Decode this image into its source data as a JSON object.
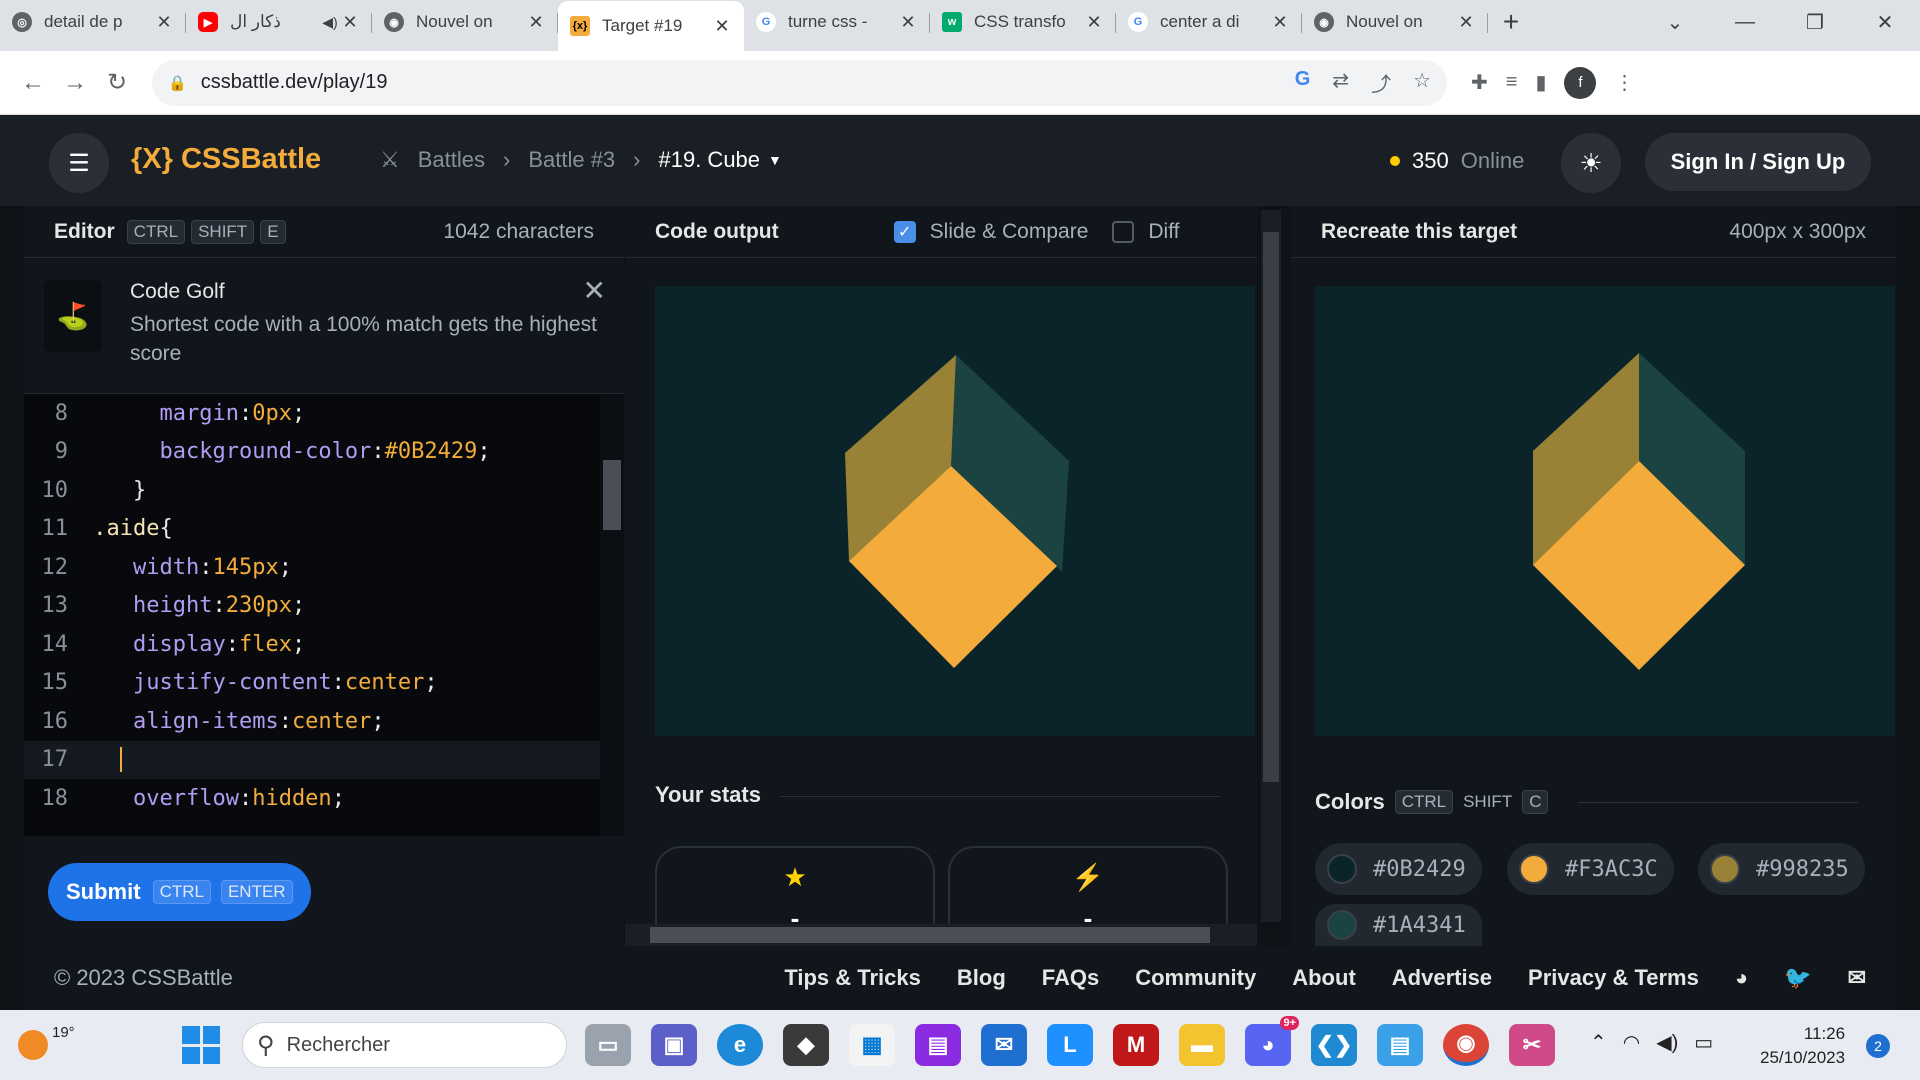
{
  "browser": {
    "tabs": [
      {
        "title": "detail de p",
        "favicon": "globe-icon"
      },
      {
        "title": "ذكار ال",
        "favicon": "youtube-icon"
      },
      {
        "title": "Nouvel on",
        "favicon": "chrome-icon"
      },
      {
        "title": "Target #19",
        "favicon": "cssbattle-icon",
        "active": true
      },
      {
        "title": "turne css -",
        "favicon": "google-icon"
      },
      {
        "title": "CSS transfo",
        "favicon": "w3schools-icon"
      },
      {
        "title": "center a di",
        "favicon": "google-icon"
      },
      {
        "title": "Nouvel on",
        "favicon": "chrome-icon"
      }
    ],
    "url": "cssbattle.dev/play/19",
    "profile_initial": "f"
  },
  "header": {
    "logo": "{X} CSSBattle",
    "crumbs": [
      "Battles",
      "Battle #3",
      "#19. Cube"
    ],
    "online_count": "350",
    "online_label": "Online",
    "signin": "Sign In / Sign Up"
  },
  "editor": {
    "title": "Editor",
    "shortcut": [
      "CTRL",
      "SHIFT",
      "E"
    ],
    "chars": "1042 characters",
    "tip_title": "Code Golf",
    "tip_text": "Shortest code with a 100% match gets the highest score",
    "lines": [
      {
        "n": "8",
        "prop": "margin",
        "val": "0px"
      },
      {
        "n": "9",
        "prop": "background-color",
        "val": "#0B2429"
      },
      {
        "n": "10",
        "raw": "}"
      },
      {
        "n": "11",
        "sel": ".aide"
      },
      {
        "n": "12",
        "prop": "width",
        "val": "145px"
      },
      {
        "n": "13",
        "prop": "height",
        "val": "230px"
      },
      {
        "n": "14",
        "prop": "display",
        "val": "flex"
      },
      {
        "n": "15",
        "prop": "justify-content",
        "val": "center"
      },
      {
        "n": "16",
        "prop": "align-items",
        "val": "center"
      },
      {
        "n": "17",
        "raw": ""
      },
      {
        "n": "18",
        "prop": "overflow",
        "val": "hidden"
      }
    ],
    "submit": "Submit",
    "submit_keys": [
      "CTRL",
      "ENTER"
    ]
  },
  "output": {
    "title": "Code output",
    "slide_compare": "Slide & Compare",
    "diff": "Diff",
    "stats_title": "Your stats",
    "stat1": "-",
    "stat2": "-"
  },
  "target": {
    "title": "Recreate this target",
    "size": "400px x 300px",
    "colors_title": "Colors",
    "colors_keys": [
      "CTRL",
      "SHIFT",
      "C"
    ],
    "colors": [
      "#0B2429",
      "#F3AC3C",
      "#998235",
      "#1A4341"
    ]
  },
  "footer": {
    "copyright": "© 2023 CSSBattle",
    "links": [
      "Tips & Tricks",
      "Blog",
      "FAQs",
      "Community",
      "About",
      "Advertise",
      "Privacy & Terms"
    ]
  },
  "taskbar": {
    "temp": "19°",
    "search": "Rechercher",
    "time": "11:26",
    "date": "25/10/2023",
    "notifications": "2",
    "discord_badge": "9+"
  }
}
